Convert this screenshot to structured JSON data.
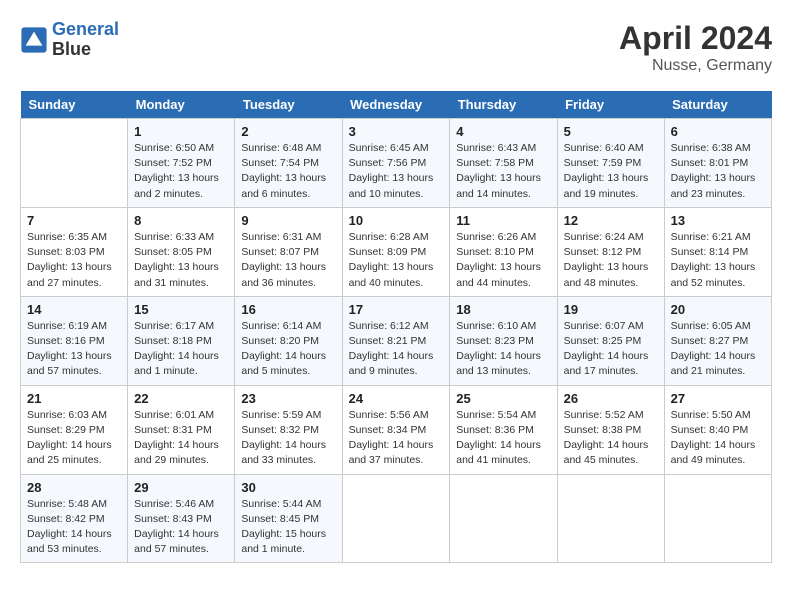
{
  "logo": {
    "line1": "General",
    "line2": "Blue"
  },
  "title": "April 2024",
  "location": "Nusse, Germany",
  "days_of_week": [
    "Sunday",
    "Monday",
    "Tuesday",
    "Wednesday",
    "Thursday",
    "Friday",
    "Saturday"
  ],
  "weeks": [
    [
      {
        "num": "",
        "sunrise": "",
        "sunset": "",
        "daylight": ""
      },
      {
        "num": "1",
        "sunrise": "Sunrise: 6:50 AM",
        "sunset": "Sunset: 7:52 PM",
        "daylight": "Daylight: 13 hours and 2 minutes."
      },
      {
        "num": "2",
        "sunrise": "Sunrise: 6:48 AM",
        "sunset": "Sunset: 7:54 PM",
        "daylight": "Daylight: 13 hours and 6 minutes."
      },
      {
        "num": "3",
        "sunrise": "Sunrise: 6:45 AM",
        "sunset": "Sunset: 7:56 PM",
        "daylight": "Daylight: 13 hours and 10 minutes."
      },
      {
        "num": "4",
        "sunrise": "Sunrise: 6:43 AM",
        "sunset": "Sunset: 7:58 PM",
        "daylight": "Daylight: 13 hours and 14 minutes."
      },
      {
        "num": "5",
        "sunrise": "Sunrise: 6:40 AM",
        "sunset": "Sunset: 7:59 PM",
        "daylight": "Daylight: 13 hours and 19 minutes."
      },
      {
        "num": "6",
        "sunrise": "Sunrise: 6:38 AM",
        "sunset": "Sunset: 8:01 PM",
        "daylight": "Daylight: 13 hours and 23 minutes."
      }
    ],
    [
      {
        "num": "7",
        "sunrise": "Sunrise: 6:35 AM",
        "sunset": "Sunset: 8:03 PM",
        "daylight": "Daylight: 13 hours and 27 minutes."
      },
      {
        "num": "8",
        "sunrise": "Sunrise: 6:33 AM",
        "sunset": "Sunset: 8:05 PM",
        "daylight": "Daylight: 13 hours and 31 minutes."
      },
      {
        "num": "9",
        "sunrise": "Sunrise: 6:31 AM",
        "sunset": "Sunset: 8:07 PM",
        "daylight": "Daylight: 13 hours and 36 minutes."
      },
      {
        "num": "10",
        "sunrise": "Sunrise: 6:28 AM",
        "sunset": "Sunset: 8:09 PM",
        "daylight": "Daylight: 13 hours and 40 minutes."
      },
      {
        "num": "11",
        "sunrise": "Sunrise: 6:26 AM",
        "sunset": "Sunset: 8:10 PM",
        "daylight": "Daylight: 13 hours and 44 minutes."
      },
      {
        "num": "12",
        "sunrise": "Sunrise: 6:24 AM",
        "sunset": "Sunset: 8:12 PM",
        "daylight": "Daylight: 13 hours and 48 minutes."
      },
      {
        "num": "13",
        "sunrise": "Sunrise: 6:21 AM",
        "sunset": "Sunset: 8:14 PM",
        "daylight": "Daylight: 13 hours and 52 minutes."
      }
    ],
    [
      {
        "num": "14",
        "sunrise": "Sunrise: 6:19 AM",
        "sunset": "Sunset: 8:16 PM",
        "daylight": "Daylight: 13 hours and 57 minutes."
      },
      {
        "num": "15",
        "sunrise": "Sunrise: 6:17 AM",
        "sunset": "Sunset: 8:18 PM",
        "daylight": "Daylight: 14 hours and 1 minute."
      },
      {
        "num": "16",
        "sunrise": "Sunrise: 6:14 AM",
        "sunset": "Sunset: 8:20 PM",
        "daylight": "Daylight: 14 hours and 5 minutes."
      },
      {
        "num": "17",
        "sunrise": "Sunrise: 6:12 AM",
        "sunset": "Sunset: 8:21 PM",
        "daylight": "Daylight: 14 hours and 9 minutes."
      },
      {
        "num": "18",
        "sunrise": "Sunrise: 6:10 AM",
        "sunset": "Sunset: 8:23 PM",
        "daylight": "Daylight: 14 hours and 13 minutes."
      },
      {
        "num": "19",
        "sunrise": "Sunrise: 6:07 AM",
        "sunset": "Sunset: 8:25 PM",
        "daylight": "Daylight: 14 hours and 17 minutes."
      },
      {
        "num": "20",
        "sunrise": "Sunrise: 6:05 AM",
        "sunset": "Sunset: 8:27 PM",
        "daylight": "Daylight: 14 hours and 21 minutes."
      }
    ],
    [
      {
        "num": "21",
        "sunrise": "Sunrise: 6:03 AM",
        "sunset": "Sunset: 8:29 PM",
        "daylight": "Daylight: 14 hours and 25 minutes."
      },
      {
        "num": "22",
        "sunrise": "Sunrise: 6:01 AM",
        "sunset": "Sunset: 8:31 PM",
        "daylight": "Daylight: 14 hours and 29 minutes."
      },
      {
        "num": "23",
        "sunrise": "Sunrise: 5:59 AM",
        "sunset": "Sunset: 8:32 PM",
        "daylight": "Daylight: 14 hours and 33 minutes."
      },
      {
        "num": "24",
        "sunrise": "Sunrise: 5:56 AM",
        "sunset": "Sunset: 8:34 PM",
        "daylight": "Daylight: 14 hours and 37 minutes."
      },
      {
        "num": "25",
        "sunrise": "Sunrise: 5:54 AM",
        "sunset": "Sunset: 8:36 PM",
        "daylight": "Daylight: 14 hours and 41 minutes."
      },
      {
        "num": "26",
        "sunrise": "Sunrise: 5:52 AM",
        "sunset": "Sunset: 8:38 PM",
        "daylight": "Daylight: 14 hours and 45 minutes."
      },
      {
        "num": "27",
        "sunrise": "Sunrise: 5:50 AM",
        "sunset": "Sunset: 8:40 PM",
        "daylight": "Daylight: 14 hours and 49 minutes."
      }
    ],
    [
      {
        "num": "28",
        "sunrise": "Sunrise: 5:48 AM",
        "sunset": "Sunset: 8:42 PM",
        "daylight": "Daylight: 14 hours and 53 minutes."
      },
      {
        "num": "29",
        "sunrise": "Sunrise: 5:46 AM",
        "sunset": "Sunset: 8:43 PM",
        "daylight": "Daylight: 14 hours and 57 minutes."
      },
      {
        "num": "30",
        "sunrise": "Sunrise: 5:44 AM",
        "sunset": "Sunset: 8:45 PM",
        "daylight": "Daylight: 15 hours and 1 minute."
      },
      {
        "num": "",
        "sunrise": "",
        "sunset": "",
        "daylight": ""
      },
      {
        "num": "",
        "sunrise": "",
        "sunset": "",
        "daylight": ""
      },
      {
        "num": "",
        "sunrise": "",
        "sunset": "",
        "daylight": ""
      },
      {
        "num": "",
        "sunrise": "",
        "sunset": "",
        "daylight": ""
      }
    ]
  ]
}
